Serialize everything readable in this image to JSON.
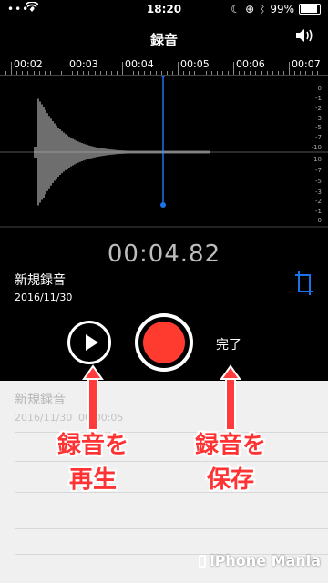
{
  "status_bar": {
    "carrier": "••••",
    "time": "18:20",
    "battery": "99%",
    "battery_level": 0.99
  },
  "header": {
    "title": "録音",
    "speaker_icon": "speaker-icon"
  },
  "timeline": {
    "labels": [
      "00:02",
      "00:03",
      "00:04",
      "00:05",
      "00:06",
      "00:07"
    ]
  },
  "waveform": {
    "db_scale_top": [
      "0",
      "-1",
      "-2",
      "-3",
      "-5",
      "-7",
      "-10"
    ],
    "db_scale_bottom": [
      "-10",
      "-7",
      "-5",
      "-3",
      "-2",
      "-1",
      "0"
    ],
    "playhead_color": "#1a73e8"
  },
  "elapsed": "00:04.82",
  "recording": {
    "name": "新規録音",
    "date": "2016/11/30"
  },
  "controls": {
    "done_label": "完了",
    "record_color": "#ff3b30"
  },
  "list": {
    "item_name": "新規録音",
    "item_date": "2016/11/30",
    "item_duration": "00:00:05"
  },
  "annotations": {
    "play_label": "録音を\n再生",
    "save_label": "録音を\n保存"
  },
  "watermark": "iPhone Mania"
}
